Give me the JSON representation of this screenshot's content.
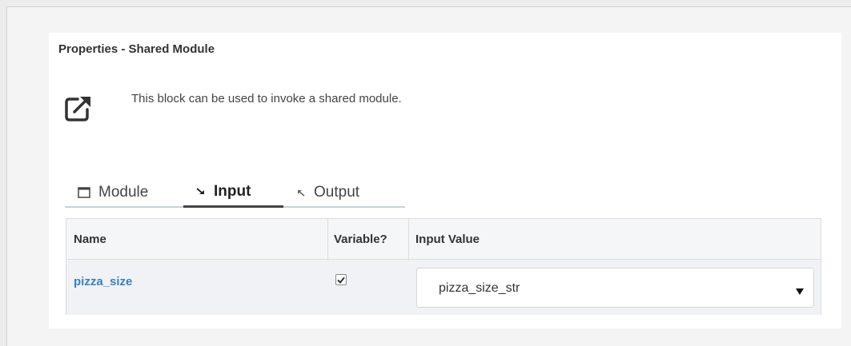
{
  "panel": {
    "title": "Properties - Shared Module",
    "description": "This block can be used to invoke a shared module.",
    "description_icon": "external-link-icon"
  },
  "tabs": [
    {
      "label": "Module",
      "icon": "window-icon",
      "active": false
    },
    {
      "label": "Input",
      "icon": "arrow-in-icon",
      "active": true
    },
    {
      "label": "Output",
      "icon": "arrow-out-icon",
      "active": false
    }
  ],
  "grid": {
    "columns": [
      "Name",
      "Variable?",
      "Input Value"
    ],
    "rows": [
      {
        "name": "pizza_size",
        "variable": true,
        "input_value": "pizza_size_str"
      }
    ]
  },
  "colors": {
    "link": "#3a7fc3",
    "active_tab_border": "#444444",
    "tab_underline": "#c8d0dc"
  }
}
